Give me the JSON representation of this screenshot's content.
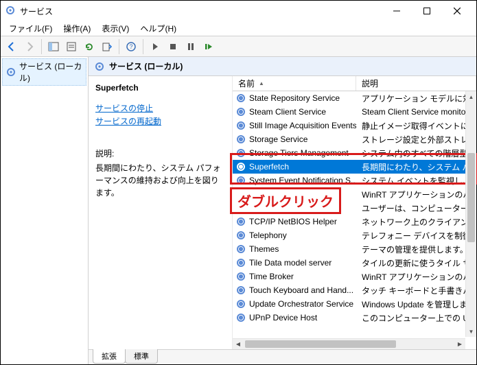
{
  "window": {
    "title": "サービス"
  },
  "menubar": [
    {
      "label": "ファイル",
      "accel": "F"
    },
    {
      "label": "操作",
      "accel": "A"
    },
    {
      "label": "表示",
      "accel": "V"
    },
    {
      "label": "ヘルプ",
      "accel": "H"
    }
  ],
  "tree": {
    "root_label": "サービス (ローカル)"
  },
  "pane_header": "サービス (ローカル)",
  "detail": {
    "selected_name": "Superfetch",
    "links": {
      "stop": "サービスの停止",
      "restart": "サービスの再起動"
    },
    "desc_label": "説明:",
    "desc_text": "長期間にわたり、システム パフォーマンスの維持および向上を図ります。"
  },
  "columns": {
    "name": "名前",
    "desc": "説明"
  },
  "services": [
    {
      "name": "State Repository Service",
      "desc": "アプリケーション モデルに対する必"
    },
    {
      "name": "Steam Client Service",
      "desc": "Steam Client Service monitors"
    },
    {
      "name": "Still Image Acquisition Events",
      "desc": "静止イメージ取得イベントに関連"
    },
    {
      "name": "Storage Service",
      "desc": "ストレージ設定と外部ストレージの"
    },
    {
      "name": "Storage Tiers Management",
      "desc": "システム内のすべての階層型記"
    },
    {
      "name": "Superfetch",
      "desc": "長期間にわたり、システム パフォー",
      "selected": true
    },
    {
      "name": "System Event Notification S...",
      "desc": "システム イベントを監視し、これら"
    },
    {
      "name": "",
      "desc": "WinRT アプリケーションのバックグ"
    },
    {
      "name": "",
      "desc": "ユーザーは、コンピューターの自動"
    },
    {
      "name": "TCP/IP NetBIOS Helper",
      "desc": "ネットワーク上のクライアントに対し"
    },
    {
      "name": "Telephony",
      "desc": "テレフォニー デバイスを制御するプ"
    },
    {
      "name": "Themes",
      "desc": "テーマの管理を提供します。"
    },
    {
      "name": "Tile Data model server",
      "desc": "タイルの更新に使うタイル サーバ"
    },
    {
      "name": "Time Broker",
      "desc": "WinRT アプリケーションのバックグ"
    },
    {
      "name": "Touch Keyboard and Hand...",
      "desc": "タッチ キーボードと手書きパネルの"
    },
    {
      "name": "Update Orchestrator Service",
      "desc": "Windows Update を管理します"
    },
    {
      "name": "UPnP Device Host",
      "desc": "このコンピューター上での UPnP デ"
    }
  ],
  "tabs": {
    "extended": "拡張",
    "standard": "標準"
  },
  "annotation": {
    "label": "ダブルクリック"
  },
  "colors": {
    "selection": "#0078d7",
    "annotation": "#d81b1b",
    "link": "#0066cc"
  }
}
